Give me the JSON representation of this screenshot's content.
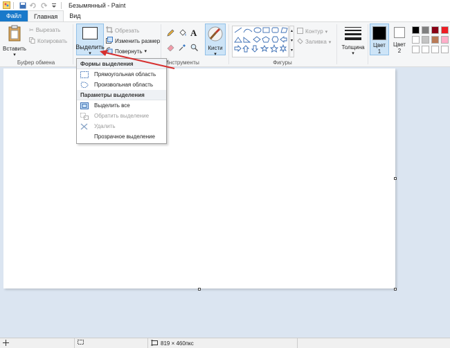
{
  "window": {
    "title": "Безымянный - Paint"
  },
  "tabs": {
    "file": "Файл",
    "home": "Главная",
    "view": "Вид"
  },
  "clipboard": {
    "paste": "Вставить",
    "cut": "Вырезать",
    "copy": "Копировать",
    "label": "Буфер обмена"
  },
  "image": {
    "select": "Выделить",
    "crop": "Обрезать",
    "resize": "Изменить размер",
    "rotate": "Повернуть"
  },
  "tools": {
    "label": "Инструменты",
    "brushes": "Кисти"
  },
  "shapes": {
    "label": "Фигуры",
    "outline": "Контур",
    "fill": "Заливка"
  },
  "size": {
    "label": "Толщина"
  },
  "colors": {
    "color1": "Цвет",
    "color1_num": "1",
    "color2": "Цвет",
    "color2_num": "2",
    "palette_row1": [
      "#000000",
      "#7f7f7f",
      "#880015",
      "#ed1c24"
    ],
    "palette_row2": [
      "#ffffff",
      "#c3c3c3",
      "#b97a57",
      "#ffaec9"
    ],
    "palette_row3": [
      "#ffffff",
      "#ffffff",
      "#ffffff",
      "#ffffff"
    ]
  },
  "dropdown": {
    "section1": "Формы выделения",
    "rect": "Прямоугольная область",
    "free": "Произвольная область",
    "section2": "Параметры выделения",
    "select_all": "Выделить все",
    "invert": "Обратить выделение",
    "delete": "Удалить",
    "transparent": "Прозрачное выделение"
  },
  "status": {
    "size": "819 × 460пкс"
  },
  "accent": {
    "file_tab": "#1979ca",
    "selected": "#cde4f7",
    "arrow": "#d62f2f"
  }
}
